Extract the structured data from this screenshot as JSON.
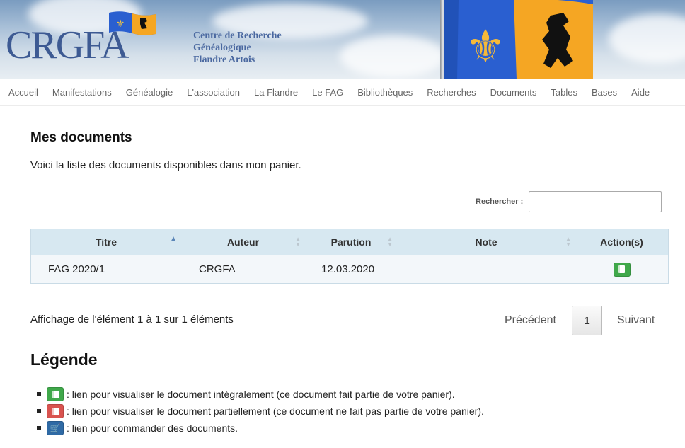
{
  "header": {
    "logo_text": "CRGFA",
    "tagline": [
      "Centre de Recherche",
      "Généalogique",
      "Flandre Artois"
    ]
  },
  "nav": {
    "items": [
      "Accueil",
      "Manifestations",
      "Généalogie",
      "L'association",
      "La Flandre",
      "Le FAG",
      "Bibliothèques",
      "Recherches",
      "Documents",
      "Tables",
      "Bases",
      "Aide"
    ]
  },
  "main": {
    "title": "Mes documents",
    "intro": "Voici la liste des documents disponibles dans mon panier.",
    "search_label": "Rechercher :",
    "search_value": ""
  },
  "table": {
    "columns": [
      "Titre",
      "Auteur",
      "Parution",
      "Note",
      "Action(s)"
    ],
    "rows": [
      {
        "titre": "FAG 2020/1",
        "auteur": "CRGFA",
        "parution": "12.03.2020",
        "note": ""
      }
    ]
  },
  "pagination": {
    "info": "Affichage de l'élément 1 à 1 sur 1 éléments",
    "prev": "Précédent",
    "page": "1",
    "next": "Suivant"
  },
  "legend": {
    "title": "Légende",
    "items": [
      {
        "icon": "book-icon",
        "color": "#3fa84a",
        "text": ": lien pour visualiser le document intégralement (ce document fait partie de votre panier)."
      },
      {
        "icon": "book-icon",
        "color": "#d9534f",
        "text": ": lien pour visualiser le document partiellement (ce document ne fait pas partie de votre panier)."
      },
      {
        "icon": "cart-icon",
        "color": "#2f6aa5",
        "text": ": lien pour commander des documents."
      }
    ]
  },
  "colors": {
    "header_blue": "#3d5a93",
    "table_header_bg": "#d7e8f1",
    "flag_blue": "#2a5fd0",
    "flag_orange": "#f5a623"
  }
}
